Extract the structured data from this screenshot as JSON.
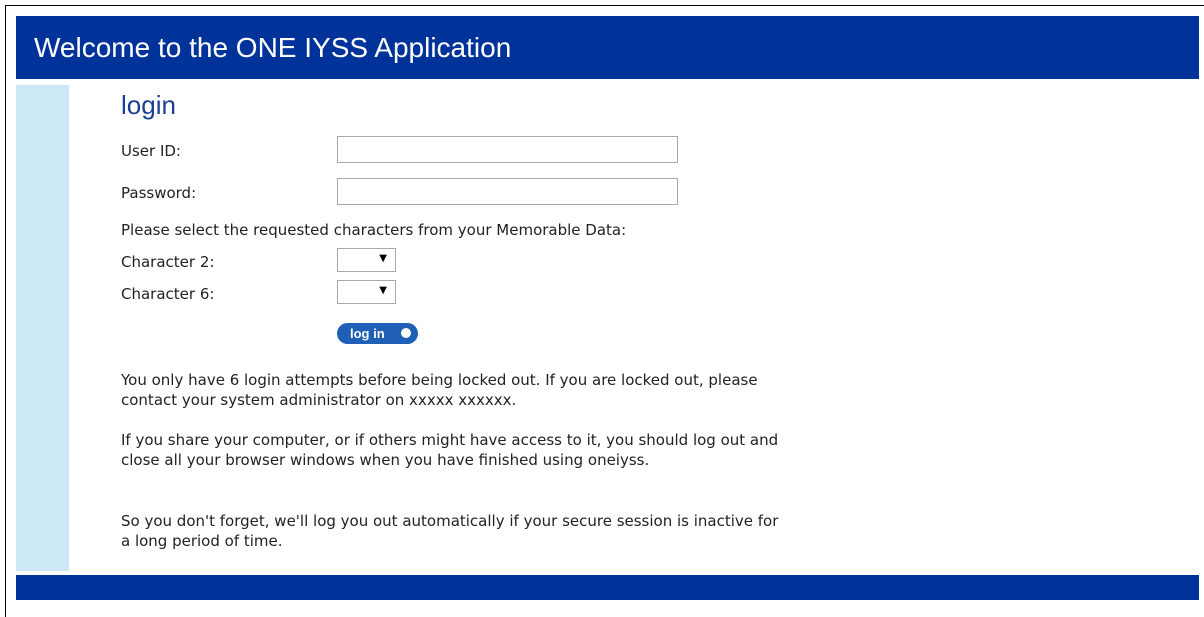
{
  "header": {
    "title": "Welcome to the ONE IYSS Application"
  },
  "login": {
    "heading": "login",
    "user_id_label": "User ID:",
    "user_id_value": "",
    "password_label": "Password:",
    "password_value": "",
    "memorable_prompt": "Please select the requested characters from your Memorable Data:",
    "char_a_label": "Character 2:",
    "char_a_selected": "",
    "char_b_label": "Character 6:",
    "char_b_selected": "",
    "button_label": "log in"
  },
  "info": {
    "attempts": "You only have 6 login attempts before being locked out. If you are locked out, please contact your system administrator on xxxxx xxxxxx.",
    "shared_computer": "If you share your computer, or if others might have access to it, you should log out and close all your browser windows when you have finished using oneiyss.",
    "auto_logout": "So you don't forget, we'll log you out automatically if your secure session is inactive for a long period of time."
  },
  "colors": {
    "header_bg": "#003399",
    "sidebar_bg": "#cce8f7",
    "heading_text": "#1a3d96",
    "button_bg": "#1f5fb5"
  },
  "icons": {
    "select_arrow": "caret-down-icon",
    "button_dot": "circle-icon"
  }
}
